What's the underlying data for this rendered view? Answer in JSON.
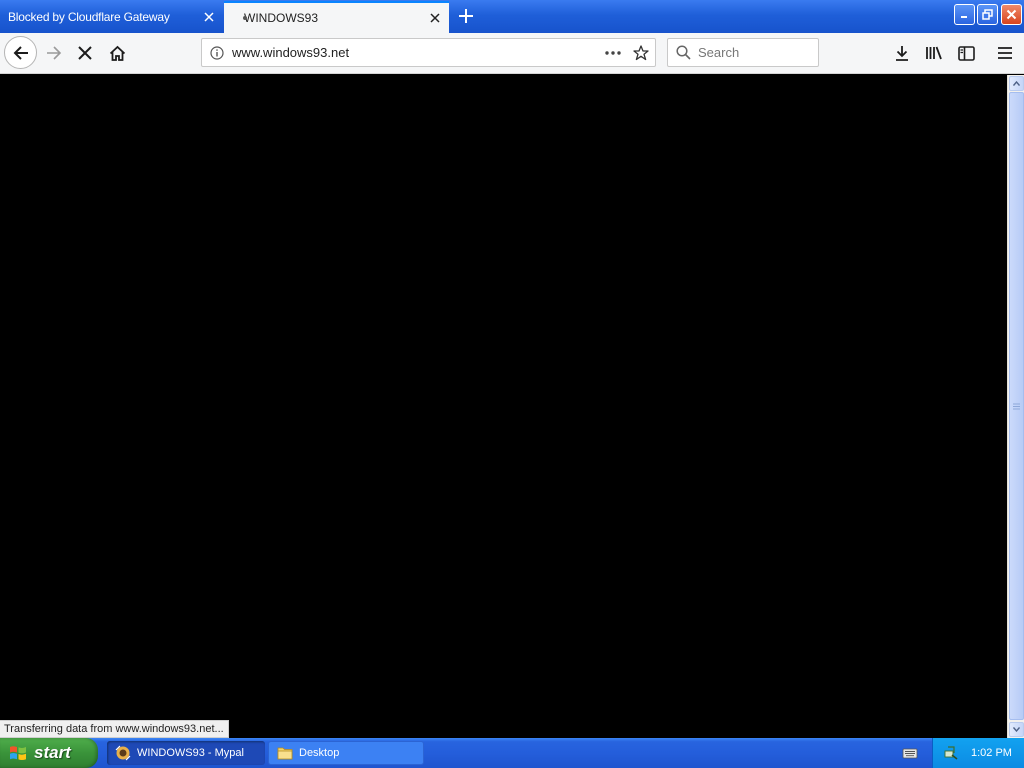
{
  "browser": {
    "tabs": [
      {
        "label": "Blocked by Cloudflare Gateway",
        "active": false
      },
      {
        "label": "WINDOWS93",
        "active": true
      }
    ],
    "url": "www.windows93.net",
    "search_placeholder": "Search",
    "status_text": "Transferring data from www.windows93.net..."
  },
  "taskbar": {
    "start_label": "start",
    "tasks": [
      {
        "label": "WINDOWS93 - Mypal",
        "active": true
      },
      {
        "label": "Desktop",
        "active": false
      }
    ],
    "clock": "1:02 PM"
  },
  "colors": {
    "xp_blue": "#245edb",
    "start_green": "#3a933a",
    "tray_blue": "#0c8be3",
    "content_bg": "#000000"
  }
}
